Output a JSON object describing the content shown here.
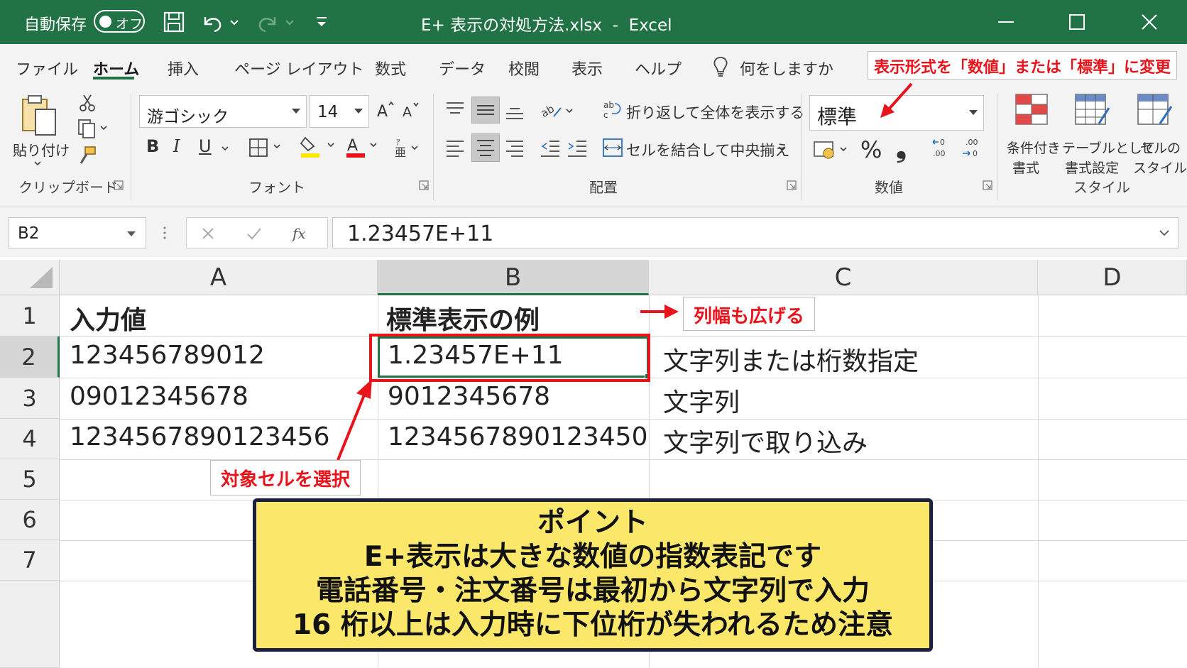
{
  "titlebar": {
    "autosave_label": "自動保存",
    "toggle_label": "オフ",
    "title": "E+ 表示の対処方法.xlsx  -  Excel"
  },
  "tabs": [
    "ファイル",
    "ホーム",
    "挿入",
    "ページ レイアウト",
    "数式",
    "データ",
    "校閲",
    "表示",
    "ヘルプ"
  ],
  "active_tab": "ホーム",
  "tellme": "何をしますか",
  "ribbon": {
    "clipboard": {
      "paste_label": "貼り付け",
      "group_label": "クリップボード"
    },
    "font": {
      "font_name": "游ゴシック",
      "font_size": "14",
      "group_label": "フォント",
      "bold": "B",
      "italic": "I",
      "underline": "U"
    },
    "alignment": {
      "wrap_text": "折り返して全体を表示する",
      "merge_center": "セルを結合して中央揃え",
      "group_label": "配置"
    },
    "number": {
      "format": "標準",
      "percent": "%",
      "comma": "❟",
      "group_label": "数値"
    },
    "styles": {
      "conditional_line1": "条件付き",
      "conditional_line2": "書式",
      "table_line1": "テーブルとして",
      "table_line2": "書式設定",
      "cell_line1": "セルの",
      "cell_line2": "スタイル",
      "group_label": "スタイル"
    }
  },
  "formula_bar": {
    "name_box": "B2",
    "formula": "1.23457E+11"
  },
  "grid": {
    "columns": [
      "A",
      "B",
      "C",
      "D"
    ],
    "rows": [
      "1",
      "2",
      "3",
      "4",
      "5",
      "6",
      "7"
    ],
    "cells": {
      "A1": "入力値",
      "B1": "標準表示の例",
      "A2": "123456789012",
      "B2": "1.23457E+11",
      "C2": "文字列または桁数指定",
      "A3": "09012345678",
      "B3": "9012345678",
      "C3": "文字列",
      "A4": "1234567890123456",
      "B4": "1234567890123450",
      "C4": "文字列で取り込み"
    }
  },
  "annotations": {
    "format_callout": "表示形式を「数値」または「標準」に変更",
    "width_callout": "列幅も広げる",
    "select_callout": "対象セルを選択",
    "point": [
      "ポイント",
      "E+表示は大きな数値の指数表記です",
      "電話番号・注文番号は最初から文字列で入力",
      "16 桁以上は入力時に下位桁が失われるため注意"
    ]
  },
  "colors": {
    "excel_green": "#217346",
    "annotation_red": "#e8141b",
    "point_yellow": "#fbe86b",
    "point_border": "#1c2040"
  }
}
